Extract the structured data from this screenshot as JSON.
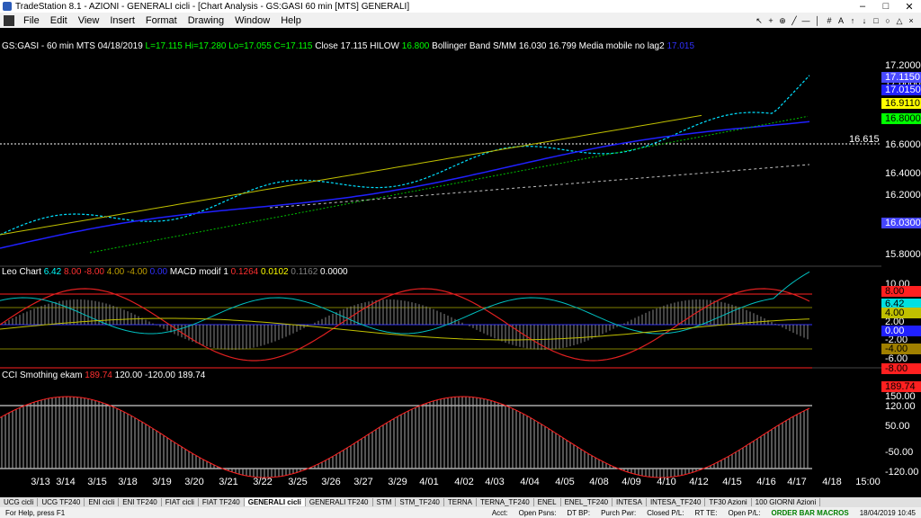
{
  "window": {
    "title": "TradeStation 8.1 - AZIONI - GENERALI cicli - [Chart Analysis - GS:GASI  60 min  [MTS] GENERALI]",
    "controls": [
      "–",
      "□",
      "✕"
    ]
  },
  "menu": [
    "File",
    "Edit",
    "View",
    "Insert",
    "Format",
    "Drawing",
    "Window",
    "Help"
  ],
  "price_panel": {
    "symbol": "GS:GASI - 60 min",
    "mts": "MTS",
    "date": "04/18/2019",
    "ohlc": "L=17.115  Hi=17.280  Lo=17.055  C=17.115",
    "close_label": "Close",
    "close_value": "17.115",
    "hilow_label": "HILOW",
    "hilow_value": "16.800",
    "bollinger_label": "Bollinger Band S/MM",
    "bollinger_values": "16.030  16.799",
    "media_label": "Media mobile no lag2",
    "media_value": "17.015",
    "level_label": "16.615",
    "axis": [
      "17.2000",
      "17.0000",
      "16.8000",
      "16.6000",
      "16.4000",
      "16.2000",
      "16.0000",
      "15.8000"
    ],
    "tags": [
      {
        "text": "17.1150",
        "bg": "#4a4aff",
        "fg": "#ffffff"
      },
      {
        "text": "17.0150",
        "bg": "#2222ff",
        "fg": "#ffffff"
      },
      {
        "text": "16.9110",
        "bg": "#ffff00",
        "fg": "#000000"
      },
      {
        "text": "16.8000",
        "bg": "#00ff00",
        "fg": "#000000"
      },
      {
        "text": "16.0300",
        "bg": "#4444ff",
        "fg": "#ffffff"
      }
    ]
  },
  "macd_panel": {
    "label": "Leo Chart",
    "values": [
      {
        "text": "6.42",
        "color": "#00ffff"
      },
      {
        "text": "8.00",
        "color": "#ff3030"
      },
      {
        "text": "-8.00",
        "color": "#ff3030"
      },
      {
        "text": "4.00",
        "color": "#c0a000"
      },
      {
        "text": "-4.00",
        "color": "#c0a000"
      },
      {
        "text": "0.00",
        "color": "#3030ff"
      }
    ],
    "macd_label": "MACD modif 1",
    "macd_values": [
      {
        "text": "0.1264",
        "color": "#ff3030"
      },
      {
        "text": "0.0102",
        "color": "#ffff00"
      },
      {
        "text": "0.1162",
        "color": "#808080"
      },
      {
        "text": "0.0000",
        "color": "#ffffff"
      }
    ],
    "axis": [
      "10.00",
      "8.00",
      "6.42",
      "4.00",
      "2.00",
      "0.00",
      "-2.00",
      "-4.00",
      "-6.00",
      "-8.00"
    ],
    "tags": [
      {
        "text": "8.00",
        "bg": "#ff2020",
        "fg": "#000000"
      },
      {
        "text": "6.42",
        "bg": "#00e0e0",
        "fg": "#000000"
      },
      {
        "text": "4.00",
        "bg": "#c0c000",
        "fg": "#000000"
      },
      {
        "text": "0.00",
        "bg": "#2020ff",
        "fg": "#ffffff"
      },
      {
        "text": "-4.00",
        "bg": "#a08000",
        "fg": "#000000"
      },
      {
        "text": "-8.00",
        "bg": "#ff2020",
        "fg": "#000000"
      }
    ]
  },
  "cci_panel": {
    "label": "CCI Smothing ekam",
    "value": "189.74",
    "values_rest": "120.00  -120.00  189.74",
    "axis": [
      "189.74",
      "150.00",
      "120.00",
      "50.00",
      "-50.00",
      "-120.00"
    ],
    "tags": [
      {
        "text": "189.74",
        "bg": "#ff2020",
        "fg": "#000000"
      }
    ]
  },
  "x_labels": [
    "3/13",
    "3/14",
    "3/15",
    "3/18",
    "3/19",
    "3/20",
    "3/21",
    "3/22",
    "3/25",
    "3/26",
    "3/27",
    "3/29",
    "4/01",
    "4/02",
    "4/03",
    "4/04",
    "4/05",
    "4/08",
    "4/09",
    "4/10",
    "4/12",
    "4/15",
    "4/16",
    "4/17",
    "4/18",
    "15:00"
  ],
  "tabs": [
    "UCG cicli",
    "UCG TF240",
    "ENI cicli",
    "ENI TF240",
    "FIAT cicli",
    "FIAT TF240",
    "GENERALI cicli",
    "GENERALI TF240",
    "STM",
    "STM_TF240",
    "TERNA",
    "TERNA_TF240",
    "ENEL",
    "ENEL_TF240",
    "INTESA",
    "INTESA_TF240",
    "TF30 Azioni",
    "100 GIORNI Azioni"
  ],
  "active_tab": "GENERALI cicli",
  "status": {
    "help": "For Help, press F1",
    "acct": "Acct:",
    "open_psns": "Open Psns:",
    "dt_bp": "DT BP:",
    "purch_pwr": "Purch Pwr:",
    "closed_pl": "Closed P/L:",
    "rt_te": "RT TE:",
    "open_pl": "Open P/L:",
    "macros": "ORDER BAR MACROS",
    "datetime": "18/04/2019 10:45"
  }
}
